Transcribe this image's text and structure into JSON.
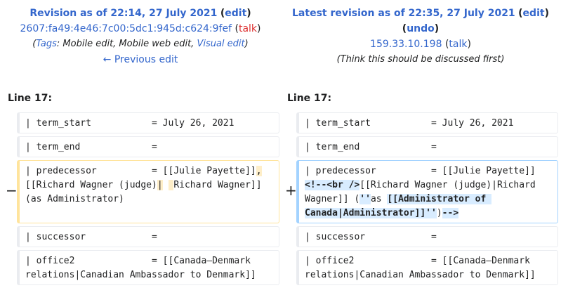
{
  "left_header": {
    "title": "Revision as of 22:14, 27 July 2021",
    "edit_label": "edit",
    "user": "2607:fa49:4e46:7c00:5dc1:945d:c624:9fef",
    "talk_label": "talk",
    "tags_label": "Tags",
    "tags_text": ": Mobile edit, Mobile web edit, ",
    "visual_edit": "Visual edit",
    "previous_edit": "← Previous edit"
  },
  "right_header": {
    "title": "Latest revision as of 22:35, 27 July 2021",
    "edit_label": "edit",
    "undo_label": "undo",
    "user": "159.33.10.198",
    "talk_label": "talk",
    "summary": "(Think this should be discussed first)"
  },
  "line_label_left": "Line 17:",
  "line_label_right": "Line 17:",
  "rows": {
    "term_start": "| term_start           = July 26, 2021",
    "term_end": "| term_end             =",
    "successor": "| successor            =",
    "office2": "| office2              = [[Canada–Denmark relations|Canadian Ambassador to Denmark]]"
  },
  "deleted": {
    "marker": "−",
    "part1": "| predecessor          = [[Julie Payette]]",
    "hl1": ",",
    "part2": " [[Richard Wagner (judge)",
    "hl2": "|",
    "part3": " ",
    "hl3": " ",
    "part4": "Richard Wagner]] (as Administrator)"
  },
  "added": {
    "marker": "+",
    "part1": "| predecessor          = [[Julie Payette]]",
    "hl1": "<!--<br />",
    "part2": "[[Richard Wagner (judge)|Richard Wagner]] (",
    "hl2": "''",
    "part3": "as ",
    "hl3": "[[Administrator of Canada|Administrator]]''",
    "part4": ")",
    "hl4": "-->"
  }
}
